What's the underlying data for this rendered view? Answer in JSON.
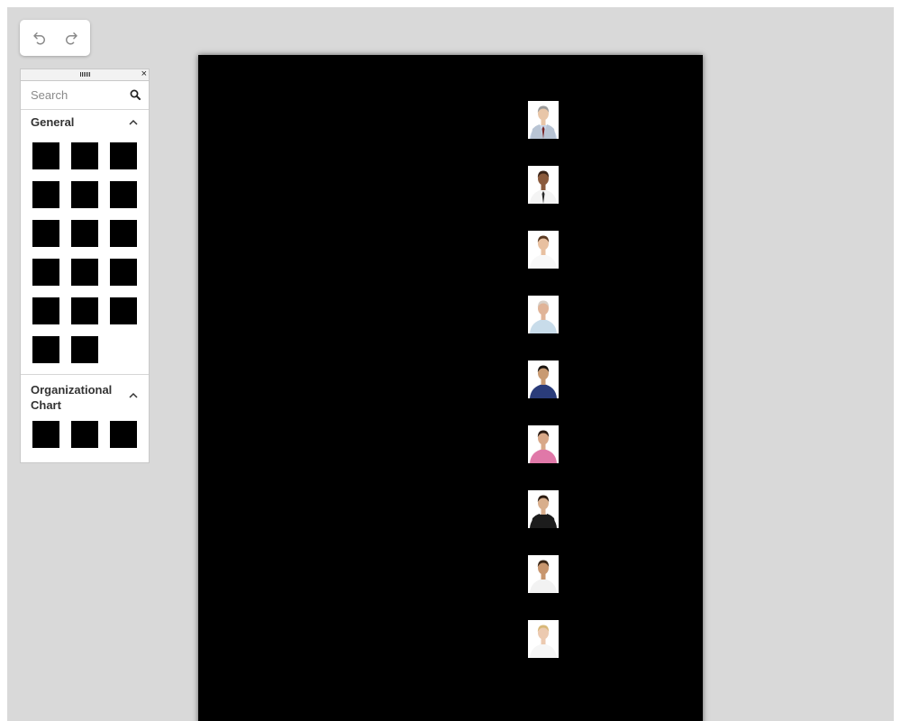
{
  "toolbar": {
    "undo_icon": "undo-icon",
    "redo_icon": "redo-icon"
  },
  "palette": {
    "close_glyph": "×",
    "search": {
      "placeholder": "Search",
      "value": "",
      "icon": "search-icon"
    },
    "sections": [
      {
        "title": "General",
        "expanded": true,
        "shape_count": 17
      },
      {
        "title": "Organizational Chart",
        "expanded": true,
        "shape_count": 3
      }
    ]
  },
  "canvas": {
    "page_color": "#000000",
    "employees": [
      {
        "photo": "man-gray-suit-red-tie",
        "skin": "#e8c6a8",
        "hair": "#9a9a9a",
        "shirt": "#c8d6ea",
        "tie": "#7a2a2a",
        "jacket": "#b8c4d4"
      },
      {
        "photo": "bald-man-white-shirt-tie",
        "skin": "#8a5a3c",
        "hair": "#3a2418",
        "shirt": "#f4f4f4",
        "tie": "#2a2a2a",
        "jacket": ""
      },
      {
        "photo": "woman-white-blouse",
        "skin": "#e8c0a0",
        "hair": "#5a3a22",
        "shirt": "#f8f8f8",
        "tie": "",
        "jacket": ""
      },
      {
        "photo": "older-bald-man",
        "skin": "#e0b498",
        "hair": "#d8d0c8",
        "shirt": "#c8dcea",
        "tie": "",
        "jacket": ""
      },
      {
        "photo": "man-blue-shirt-arms-crossed",
        "skin": "#c89a72",
        "hair": "#1a1410",
        "shirt": "#2a3c7a",
        "tie": "",
        "jacket": ""
      },
      {
        "photo": "woman-pink-top",
        "skin": "#d8a888",
        "hair": "#2a1a12",
        "shirt": "#e078a8",
        "tie": "",
        "jacket": ""
      },
      {
        "photo": "woman-black-jacket",
        "skin": "#d8ae8c",
        "hair": "#2a1a10",
        "shirt": "#1c1c1c",
        "tie": "",
        "jacket": "#1c1c1c"
      },
      {
        "photo": "young-man-white-tshirt",
        "skin": "#c8966e",
        "hair": "#3a2616",
        "shirt": "#f2f2f2",
        "tie": "",
        "jacket": ""
      },
      {
        "photo": "blonde-woman-white-top",
        "skin": "#eccab0",
        "hair": "#d8b878",
        "shirt": "#f6f6f6",
        "tie": "",
        "jacket": ""
      }
    ]
  }
}
